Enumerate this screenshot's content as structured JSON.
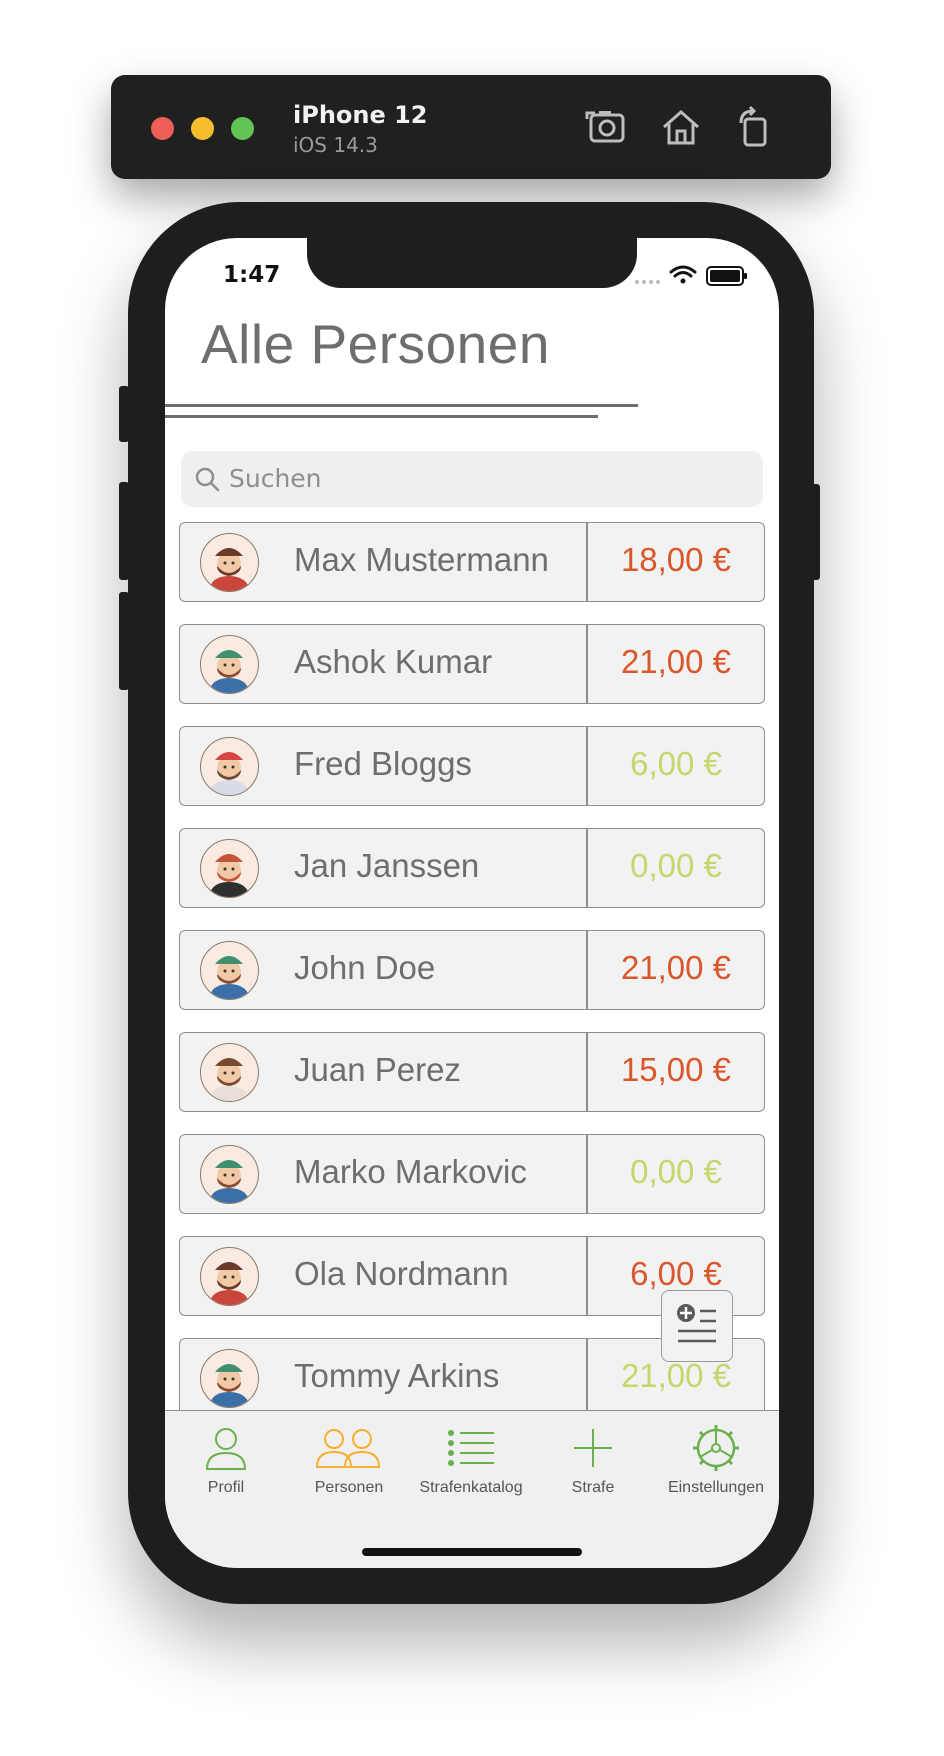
{
  "simulator": {
    "device_name": "iPhone 12",
    "os_version": "iOS 14.3",
    "icons": [
      "screenshot-icon",
      "home-icon",
      "rotate-icon"
    ]
  },
  "status_bar": {
    "time": "1:47"
  },
  "page": {
    "title": "Alle Personen"
  },
  "search": {
    "placeholder": "Suchen"
  },
  "colors": {
    "debt": "#d9572a",
    "paid": "#c5d66a",
    "accent": "#f5b131",
    "tab_green": "#6ab04c"
  },
  "people": [
    {
      "name": "Max Mustermann",
      "amount": "18,00 €",
      "status": "debt",
      "avatar": "top-hat-avatar"
    },
    {
      "name": "Ashok Kumar",
      "amount": "21,00 €",
      "status": "debt",
      "avatar": "green-cap-avatar"
    },
    {
      "name": "Fred Bloggs",
      "amount": "6,00 €",
      "status": "paid",
      "avatar": "santa-hat-avatar"
    },
    {
      "name": "Jan Janssen",
      "amount": "0,00 €",
      "status": "paid",
      "avatar": "red-hair-avatar"
    },
    {
      "name": "John Doe",
      "amount": "21,00 €",
      "status": "debt",
      "avatar": "green-cap-avatar"
    },
    {
      "name": "Juan Perez",
      "amount": "15,00 €",
      "status": "debt",
      "avatar": "glasses-avatar"
    },
    {
      "name": "Marko Markovic",
      "amount": "0,00 €",
      "status": "paid",
      "avatar": "green-cap-avatar"
    },
    {
      "name": "Ola Nordmann",
      "amount": "6,00 €",
      "status": "debt",
      "avatar": "top-hat-avatar"
    },
    {
      "name": "Tommy Arkins",
      "amount": "21,00 €",
      "status": "paid",
      "avatar": "green-cap-avatar"
    }
  ],
  "tabbar": {
    "items": [
      {
        "label": "Profil",
        "icon": "person-icon",
        "active": false
      },
      {
        "label": "Personen",
        "icon": "people-icon",
        "active": true
      },
      {
        "label": "Strafenkatalog",
        "icon": "list-icon",
        "active": false
      },
      {
        "label": "Strafe",
        "icon": "plus-icon",
        "active": false
      },
      {
        "label": "Einstellungen",
        "icon": "gear-icon",
        "active": false
      }
    ]
  }
}
